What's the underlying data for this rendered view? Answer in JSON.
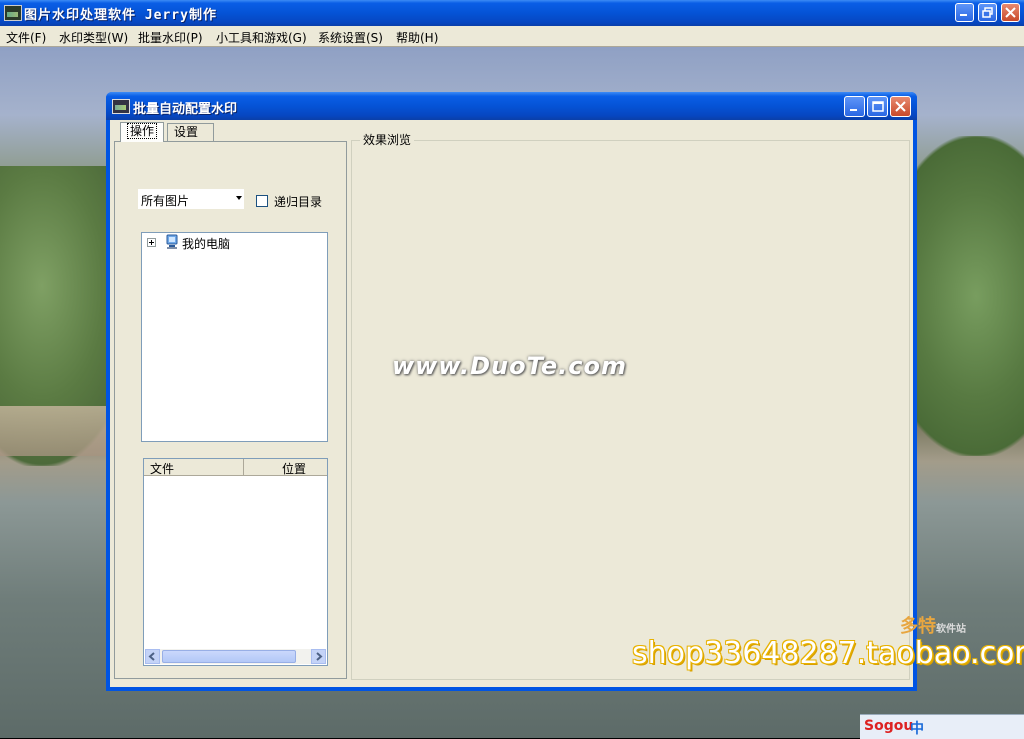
{
  "window": {
    "title": "图片水印处理软件  Jerry制作"
  },
  "menu": [
    {
      "label": "文件(F)"
    },
    {
      "label": "水印类型(W)"
    },
    {
      "label": "批量水印(P)"
    },
    {
      "label": "小工具和游戏(G)"
    },
    {
      "label": "系统设置(S)"
    },
    {
      "label": "帮助(H)"
    }
  ],
  "dialog": {
    "title": "批量自动配置水印",
    "tabs": [
      {
        "label": "操作"
      },
      {
        "label": "设置"
      }
    ],
    "filter": {
      "selected": "所有图片",
      "recursive_label": "递归目录",
      "recursive_checked": false
    },
    "tree": {
      "root_label": "我的电脑"
    },
    "file_list": {
      "columns": [
        "文件",
        "位置"
      ]
    },
    "preview": {
      "group_label": "效果浏览",
      "watermark_text": "www.DuoTe.com"
    }
  },
  "overlays": {
    "brand_name": "多特",
    "brand_sub": "软件站",
    "shop_text": "shop33648287.taobao.com",
    "ime_logo": "Sogou",
    "ime_mode": "中"
  },
  "colors": {
    "title_blue": "#0553d6",
    "dialog_bg": "#ece9d8",
    "close_red": "#c94a2a"
  }
}
